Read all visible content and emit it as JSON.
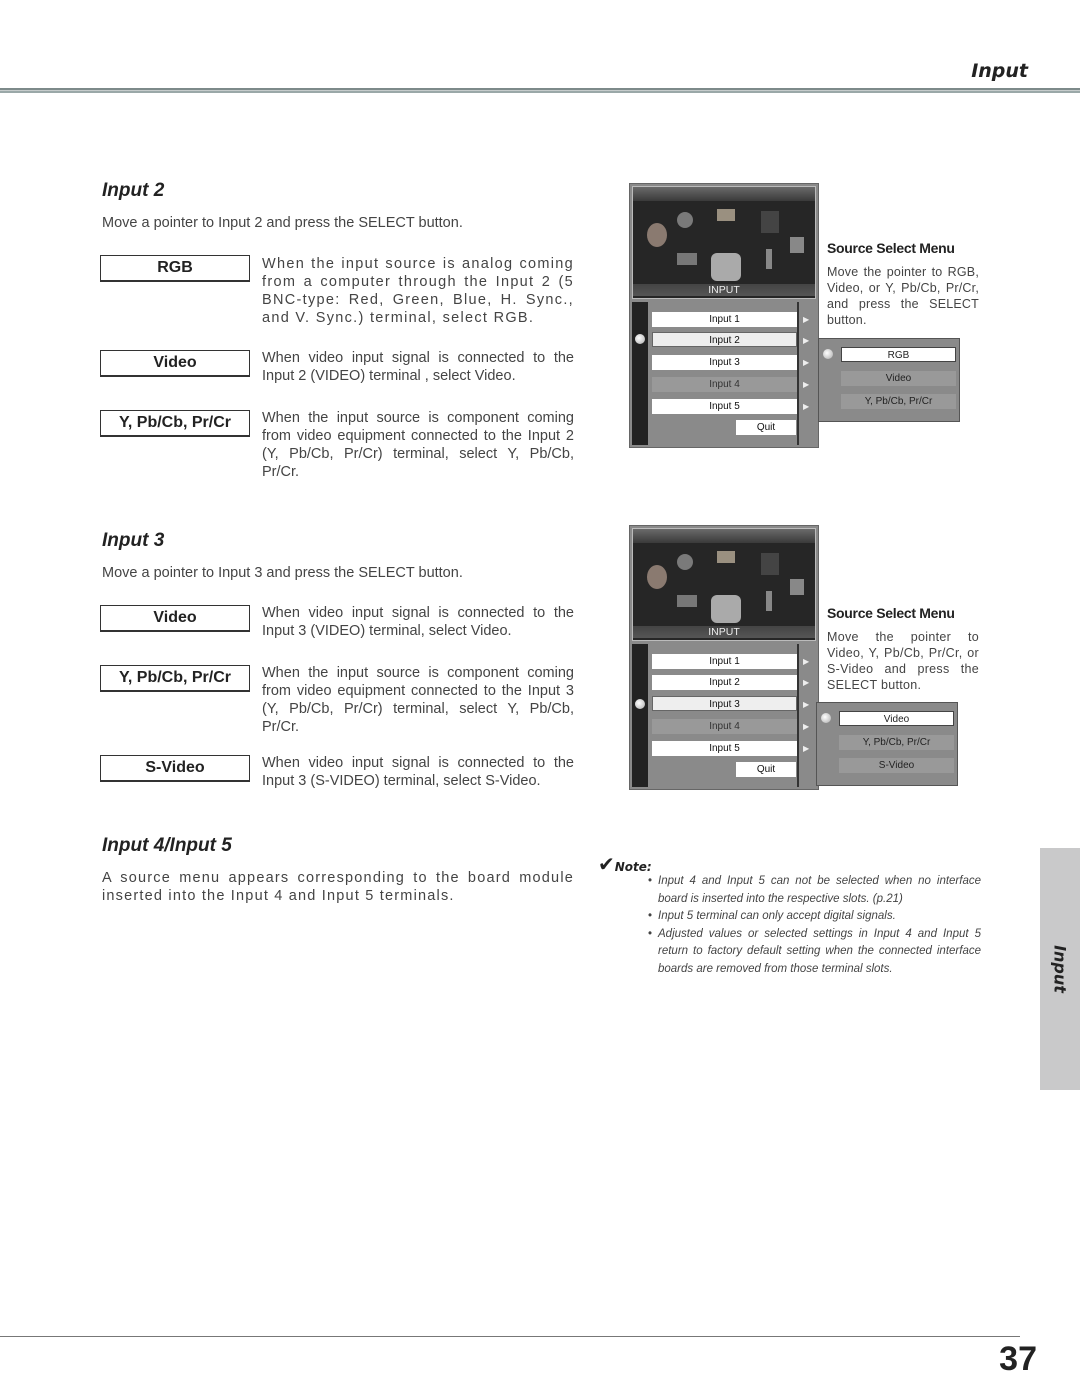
{
  "header": {
    "title": "Input"
  },
  "sections": {
    "input2": {
      "title": "Input 2",
      "intro": "Move a pointer to Input 2 and press the SELECT button.",
      "options": [
        {
          "label": "RGB",
          "description": "When the input source is analog coming from a computer through the Input 2 (5 BNC-type: Red, Green, Blue, H. Sync., and V. Sync.) terminal, select RGB."
        },
        {
          "label": "Video",
          "description": "When video input signal is connected to the Input 2 (VIDEO) terminal , select Video."
        },
        {
          "label": "Y, Pb/Cb, Pr/Cr",
          "description": "When the input source is component coming from video equipment connected to the Input 2 (Y, Pb/Cb, Pr/Cr) terminal, select Y, Pb/Cb, Pr/Cr."
        }
      ],
      "osd": {
        "label": "INPUT",
        "items": [
          "Input 1",
          "Input 2",
          "Input 3",
          "Input 4",
          "Input 5"
        ],
        "selected": "Input 2",
        "disabled": [
          "Input 4"
        ],
        "quit": "Quit",
        "submenu": [
          "RGB",
          "Video",
          "Y, Pb/Cb, Pr/Cr"
        ],
        "submenu_selected": "RGB"
      },
      "source_menu": {
        "title": "Source Select Menu",
        "description": "Move the pointer to RGB, Video, or Y, Pb/Cb, Pr/Cr, and press the SELECT button."
      }
    },
    "input3": {
      "title": "Input 3",
      "intro": "Move a pointer to Input 3 and press the SELECT button.",
      "options": [
        {
          "label": "Video",
          "description": "When video input signal is connected to the Input 3 (VIDEO) terminal, select Video."
        },
        {
          "label": "Y, Pb/Cb, Pr/Cr",
          "description": "When the input source is component coming from video equipment connected to the Input 3 (Y, Pb/Cb, Pr/Cr) terminal, select Y, Pb/Cb, Pr/Cr."
        },
        {
          "label": "S-Video",
          "description": "When video input signal is connected to the Input 3 (S-VIDEO) terminal, select S-Video."
        }
      ],
      "osd": {
        "label": "INPUT",
        "items": [
          "Input 1",
          "Input 2",
          "Input 3",
          "Input 4",
          "Input 5"
        ],
        "selected": "Input 3",
        "disabled": [
          "Input 4"
        ],
        "quit": "Quit",
        "submenu": [
          "Video",
          "Y, Pb/Cb, Pr/Cr",
          "S-Video"
        ],
        "submenu_selected": "Video"
      },
      "source_menu": {
        "title": "Source Select Menu",
        "description": "Move the pointer to Video, Y, Pb/Cb, Pr/Cr, or S-Video and press the SELECT button."
      }
    },
    "input45": {
      "title": "Input 4/Input 5",
      "description": "A source menu appears corresponding to the board module inserted into the Input 4 and Input 5 terminals."
    }
  },
  "note": {
    "heading": "Note:",
    "icon": "checkmark-icon",
    "items": [
      "Input 4 and Input 5 can not be selected when no interface board is inserted into the respective slots. (p.21)",
      "Input 5 terminal can only accept digital signals.",
      "Adjusted values or selected settings in Input 4 and Input 5 return to factory default setting when the connected interface boards are removed from those terminal slots."
    ]
  },
  "side_tab": {
    "label": "Input"
  },
  "page_number": "37"
}
